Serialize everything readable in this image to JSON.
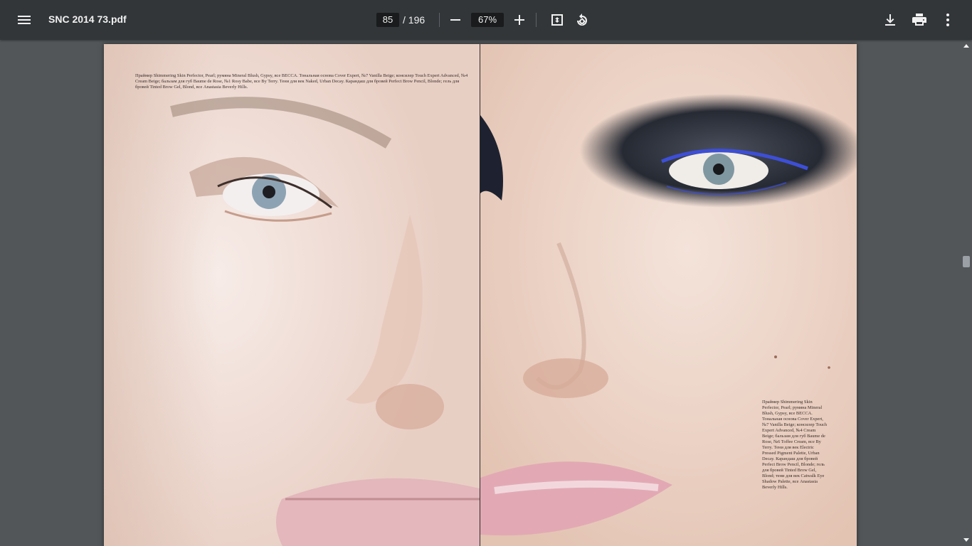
{
  "toolbar": {
    "menu_icon": "menu-icon",
    "title": "SNC 2014 73.pdf",
    "page_current": "85",
    "page_total": "/ 196",
    "zoom_value": "67%",
    "icons": [
      "zoom-out-icon",
      "zoom-in-icon",
      "fit-page-icon",
      "rotate-icon",
      "download-icon",
      "print-icon",
      "more-vert-icon"
    ]
  },
  "document": {
    "left_page_caption": "Праймер Shimmering Skin Perfector, Pearl; румяна Mineral Blush, Gypsy, все BECCA. Тональная основа Cover Expert, №7 Vanilla Beige; консилер Touch Expert Advanced, №4 Cream Beige; бальзам для губ Baume de Rose, №1 Rosy Babe, все By Terry. Тени для век Naked, Urban Decay. Карандаш для бровей Perfect Brow Pencil, Blonde; гель для бровей Tinted Brow Gel, Blond, все Anastasia Beverly Hills.",
    "right_page_caption": "Праймер Shimmering Skin Perfector, Pearl; румяна Mineral Blush, Gypsy, все BECCA. Тональная основа Cover Expert, №7 Vanilla Beige; консилер Touch Expert Advanced, №4 Cream Beige; бальзам для губ Baume de Rose, №6 Toffee Cream, все By Terry. Тени для век Electric Pressed Pigment Palette, Urban Decay. Карандаш для бровей Perfect Brow Pencil, Blonde; гель для бровей Tinted Brow Gel, Blond; тени для век Catwalk Eye Shadow Palette, все Anastasia Beverly Hills."
  },
  "colors": {
    "toolbar_bg": "#323639",
    "viewer_bg": "#525659",
    "eyeshadow_dark": "#2a2e38",
    "mascara_blue": "#3d4fd6",
    "lip_pink": "#e6aab3"
  }
}
